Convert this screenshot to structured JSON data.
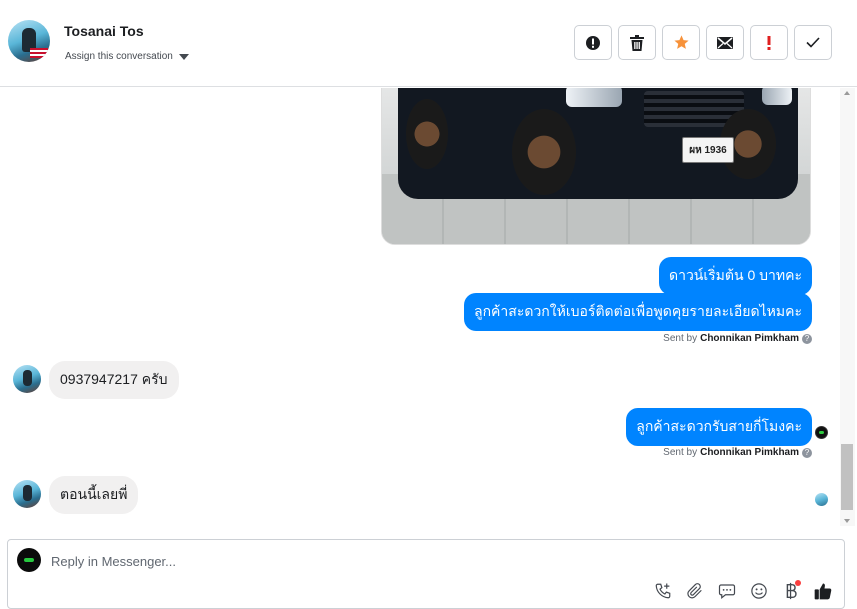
{
  "header": {
    "contact_name": "Tosanai Tos",
    "assign_label": "Assign this conversation",
    "actions": [
      {
        "name": "mark-spam-button",
        "icon": "alert-circle-icon"
      },
      {
        "name": "delete-button",
        "icon": "trash-icon"
      },
      {
        "name": "star-button",
        "icon": "star-icon",
        "color": "#f7923a"
      },
      {
        "name": "mark-unread-button",
        "icon": "envelope-icon"
      },
      {
        "name": "follow-up-button",
        "icon": "exclamation-icon",
        "color": "#e02020"
      },
      {
        "name": "mark-done-button",
        "icon": "checkmark-icon"
      }
    ]
  },
  "thread": {
    "photo_plate": "ผห 1936",
    "messages": [
      {
        "direction": "out",
        "text": "ดาวน์เริ่มต้น 0 บาทคะ"
      },
      {
        "direction": "out",
        "text": "ลูกค้าสะดวกให้เบอร์ติดต่อเพื่อพูดคุยรายละเอียดไหมคะ"
      },
      {
        "direction": "in",
        "text": "0937947217 ครับ"
      },
      {
        "direction": "out",
        "text": "ลูกค้าสะดวกรับสายกี่โมงคะ"
      },
      {
        "direction": "in",
        "text": "ตอนนี้เลยพี่"
      }
    ],
    "sent_by_prefix": "Sent by",
    "sent_by_name": "Chonnikan Pimkham",
    "help_glyph": "?"
  },
  "composer": {
    "placeholder": "Reply in Messenger...",
    "tools": [
      "call-add-icon",
      "paperclip-icon",
      "saved-reply-icon",
      "emoji-icon",
      "baht-payment-icon",
      "thumbs-up-icon"
    ]
  },
  "colors": {
    "outgoing_bubble": "#0084ff",
    "incoming_bubble": "#f1f0f0",
    "notification_dot": "#fa3e3e"
  }
}
